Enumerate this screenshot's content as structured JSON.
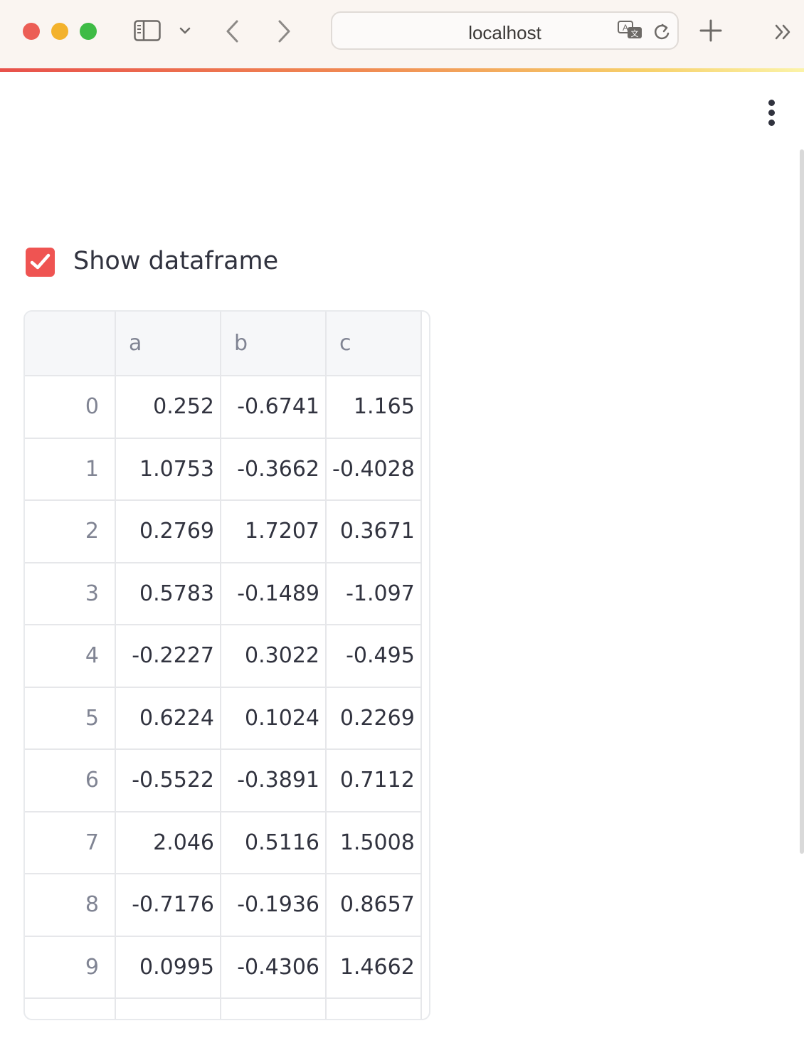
{
  "browser": {
    "url": "localhost",
    "icons": [
      "sidebar-toggle-icon",
      "chevron-down-icon",
      "back-icon",
      "forward-icon",
      "translate-icon",
      "reload-icon",
      "plus-icon",
      "double-chevron-right-icon"
    ]
  },
  "app": {
    "menu_icon": "kebab-menu-icon",
    "accent_color": "#ef5452",
    "checkbox": {
      "label": "Show dataframe",
      "checked": true
    },
    "dataframe": {
      "columns": [
        "",
        "a",
        "b",
        "c"
      ],
      "rows": [
        {
          "index": "0",
          "a": "0.252",
          "b": "-0.6741",
          "c": "1.165"
        },
        {
          "index": "1",
          "a": "1.0753",
          "b": "-0.3662",
          "c": "-0.4028"
        },
        {
          "index": "2",
          "a": "0.2769",
          "b": "1.7207",
          "c": "0.3671"
        },
        {
          "index": "3",
          "a": "0.5783",
          "b": "-0.1489",
          "c": "-1.097"
        },
        {
          "index": "4",
          "a": "-0.2227",
          "b": "0.3022",
          "c": "-0.495"
        },
        {
          "index": "5",
          "a": "0.6224",
          "b": "0.1024",
          "c": "0.2269"
        },
        {
          "index": "6",
          "a": "-0.5522",
          "b": "-0.3891",
          "c": "0.7112"
        },
        {
          "index": "7",
          "a": "2.046",
          "b": "0.5116",
          "c": "1.5008"
        },
        {
          "index": "8",
          "a": "-0.7176",
          "b": "-0.1936",
          "c": "0.8657"
        },
        {
          "index": "9",
          "a": "0.0995",
          "b": "-0.4306",
          "c": "1.4662"
        }
      ]
    }
  }
}
